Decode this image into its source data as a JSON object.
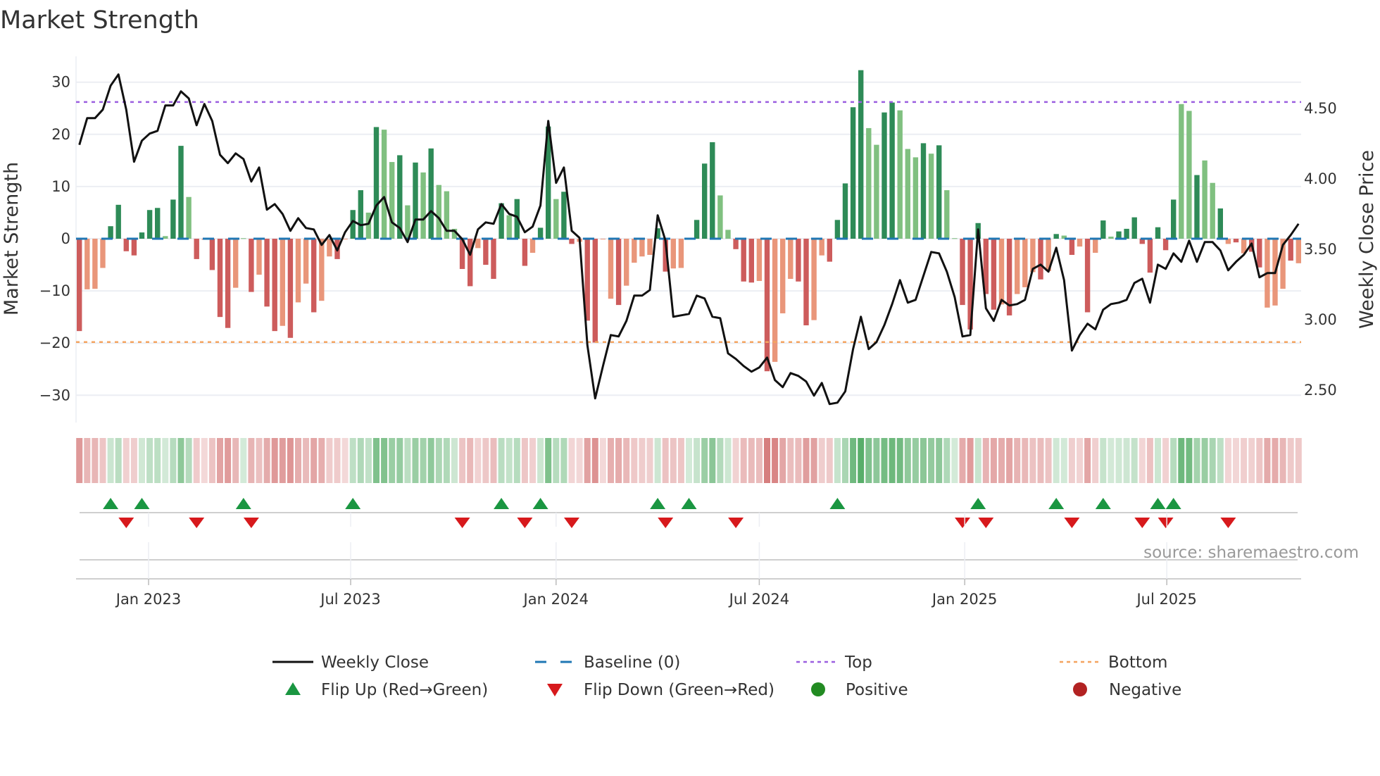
{
  "chart_data": {
    "type": "bar",
    "title": "Market Strength",
    "ylabel": "Market Strength",
    "y2label": "Weekly Close Price",
    "ylim": [
      -35,
      35
    ],
    "y2lim": [
      2.2,
      4.85
    ],
    "yticks": [
      "30",
      "20",
      "10",
      "0",
      "−10",
      "−20",
      "−30"
    ],
    "ytick_values": [
      30,
      20,
      10,
      0,
      -10,
      -20,
      -30
    ],
    "y2ticks": [
      "4.50",
      "4.00",
      "3.50",
      "3.00",
      "2.50"
    ],
    "y2tick_values": [
      4.5,
      4.0,
      3.5,
      3.0,
      2.5
    ],
    "xticks": [
      "Jan 2023",
      "Jul 2023",
      "Jan 2024",
      "Jul 2024",
      "Jan 2025",
      "Jul 2025"
    ],
    "xtick_dates": [
      "2023-01-01",
      "2023-07-01",
      "2024-01-01",
      "2024-07-01",
      "2025-01-01",
      "2025-07-01"
    ],
    "start_date": "2022-10-31",
    "interval": "weekly",
    "top_level": 26.2,
    "bottom_level": -19.8,
    "baseline": 0,
    "grid": true,
    "legend_position": "bottom",
    "source": "source: sharemaestro.com",
    "strength": [
      -17.7,
      -9.7,
      -9.6,
      -5.6,
      2.4,
      6.5,
      -2.4,
      -3.2,
      1.2,
      5.5,
      5.9,
      0.5,
      7.5,
      17.8,
      8.0,
      -3.9,
      -0.2,
      -6.0,
      -15.0,
      -17.1,
      -9.4,
      0.1,
      -10.2,
      -6.9,
      -13.0,
      -17.7,
      -16.7,
      -19.0,
      -12.2,
      -8.6,
      -14.1,
      -11.9,
      -3.4,
      -3.9,
      -0.1,
      5.5,
      9.3,
      5.0,
      21.4,
      20.9,
      14.7,
      16.0,
      6.4,
      14.6,
      12.7,
      17.3,
      10.3,
      9.1,
      1.9,
      -5.8,
      -9.1,
      -1.8,
      -5.0,
      -7.7,
      6.8,
      4.5,
      7.6,
      -5.2,
      -2.7,
      2.1,
      21.5,
      7.6,
      9.0,
      -1.0,
      -0.6,
      -15.7,
      -19.9,
      -0.1,
      -11.5,
      -12.7,
      -9.0,
      -4.6,
      -3.4,
      -3.1,
      2.0,
      -6.3,
      -5.7,
      -5.6,
      0.1,
      3.6,
      14.4,
      18.5,
      8.3,
      1.7,
      -2.0,
      -8.2,
      -8.4,
      -8.1,
      -25.4,
      -23.6,
      -14.3,
      -7.7,
      -8.2,
      -16.6,
      -15.6,
      -3.2,
      -4.4,
      3.6,
      10.6,
      25.2,
      32.3,
      21.2,
      18.0,
      24.2,
      26.1,
      24.6,
      17.2,
      15.6,
      18.3,
      16.3,
      17.9,
      9.3,
      0.1,
      -12.7,
      -17.4,
      3.0,
      -10.6,
      -13.6,
      -12.6,
      -14.7,
      -10.6,
      -9.3,
      -6.4,
      -7.8,
      -6.2,
      0.9,
      0.6,
      -3.1,
      -1.5,
      -14.1,
      -2.7,
      3.5,
      0.4,
      1.4,
      1.9,
      4.1,
      -1.0,
      -6.5,
      2.2,
      -2.2,
      7.5,
      25.8,
      24.5,
      12.2,
      15.0,
      10.7,
      5.8,
      -1.0,
      -0.7,
      -2.8,
      -2.5,
      -5.5,
      -13.2,
      -12.8,
      -9.6,
      -4.2,
      -4.7
    ],
    "strong": [
      1,
      0,
      0,
      0,
      1,
      1,
      1,
      1,
      1,
      1,
      1,
      0,
      1,
      1,
      0,
      1,
      0,
      1,
      1,
      1,
      0,
      0,
      1,
      0,
      1,
      1,
      0,
      1,
      0,
      0,
      1,
      0,
      0,
      1,
      0,
      1,
      1,
      0,
      1,
      0,
      0,
      1,
      0,
      1,
      0,
      1,
      0,
      0,
      0,
      1,
      1,
      0,
      1,
      1,
      1,
      0,
      1,
      1,
      0,
      1,
      1,
      0,
      1,
      1,
      0,
      1,
      1,
      0,
      0,
      1,
      0,
      0,
      0,
      0,
      1,
      1,
      0,
      0,
      0,
      1,
      1,
      1,
      0,
      0,
      1,
      1,
      1,
      0,
      1,
      0,
      0,
      0,
      1,
      1,
      0,
      0,
      1,
      1,
      1,
      1,
      1,
      0,
      0,
      1,
      1,
      0,
      0,
      0,
      1,
      0,
      1,
      0,
      0,
      1,
      1,
      1,
      1,
      1,
      0,
      1,
      0,
      0,
      0,
      1,
      0,
      1,
      0,
      1,
      0,
      1,
      0,
      1,
      0,
      1,
      1,
      1,
      1,
      1,
      1,
      1,
      1,
      0,
      0,
      1,
      0,
      0,
      1,
      0,
      1,
      0,
      1,
      1,
      0,
      0,
      0,
      1
    ],
    "close": [
      4.24,
      4.43,
      4.43,
      4.49,
      4.66,
      4.74,
      4.49,
      4.12,
      4.27,
      4.32,
      4.34,
      4.52,
      4.52,
      4.62,
      4.57,
      4.38,
      4.53,
      4.41,
      4.17,
      4.11,
      4.18,
      4.14,
      3.98,
      4.08,
      3.78,
      3.82,
      3.75,
      3.63,
      3.72,
      3.65,
      3.64,
      3.53,
      3.6,
      3.49,
      3.62,
      3.7,
      3.67,
      3.68,
      3.81,
      3.87,
      3.69,
      3.65,
      3.55,
      3.71,
      3.71,
      3.77,
      3.72,
      3.63,
      3.63,
      3.57,
      3.46,
      3.64,
      3.69,
      3.68,
      3.82,
      3.75,
      3.73,
      3.62,
      3.66,
      3.81,
      4.41,
      3.97,
      4.08,
      3.63,
      3.58,
      2.82,
      2.44,
      2.67,
      2.89,
      2.88,
      2.99,
      3.17,
      3.17,
      3.21,
      3.74,
      3.56,
      3.02,
      3.03,
      3.04,
      3.17,
      3.15,
      3.02,
      3.01,
      2.76,
      2.72,
      2.67,
      2.63,
      2.66,
      2.73,
      2.57,
      2.52,
      2.62,
      2.6,
      2.56,
      2.46,
      2.55,
      2.4,
      2.41,
      2.49,
      2.79,
      3.02,
      2.79,
      2.84,
      2.96,
      3.11,
      3.28,
      3.12,
      3.14,
      3.31,
      3.48,
      3.47,
      3.34,
      3.16,
      2.88,
      2.89,
      3.64,
      3.08,
      2.99,
      3.14,
      3.1,
      3.11,
      3.14,
      3.36,
      3.39,
      3.34,
      3.51,
      3.28,
      2.78,
      2.89,
      2.97,
      2.93,
      3.07,
      3.11,
      3.12,
      3.14,
      3.26,
      3.29,
      3.12,
      3.39,
      3.36,
      3.47,
      3.41,
      3.56,
      3.41,
      3.55,
      3.55,
      3.49,
      3.35,
      3.41,
      3.46,
      3.54,
      3.3,
      3.33,
      3.33,
      3.53,
      3.6,
      3.68
    ],
    "legend": [
      {
        "label": "Weekly Close",
        "icon": "line-icon"
      },
      {
        "label": "Baseline (0)",
        "icon": "dashed-line-icon"
      },
      {
        "label": "Top",
        "icon": "dotted-line-icon"
      },
      {
        "label": "Bottom",
        "icon": "dotted-line-icon"
      },
      {
        "label": "Flip Up (Red→Green)",
        "icon": "triangle-up-icon"
      },
      {
        "label": "Flip Down (Green→Red)",
        "icon": "triangle-down-icon"
      },
      {
        "label": "Positive",
        "icon": "circle-icon"
      },
      {
        "label": "Negative",
        "icon": "circle-icon"
      }
    ],
    "colors": {
      "pos_strong": "#2e8b57",
      "pos_weak": "#80c080",
      "neg_strong": "#cd5c5c",
      "neg_weak": "#e9967a",
      "close": "#111111",
      "baseline": "#1f77b4",
      "top": "#9b5fe0",
      "bottom": "#f4a460",
      "flip_up": "#1a9641",
      "flip_down": "#d7191c",
      "positive": "#228b22",
      "negative": "#b22222",
      "grid": "#eceef3"
    }
  }
}
